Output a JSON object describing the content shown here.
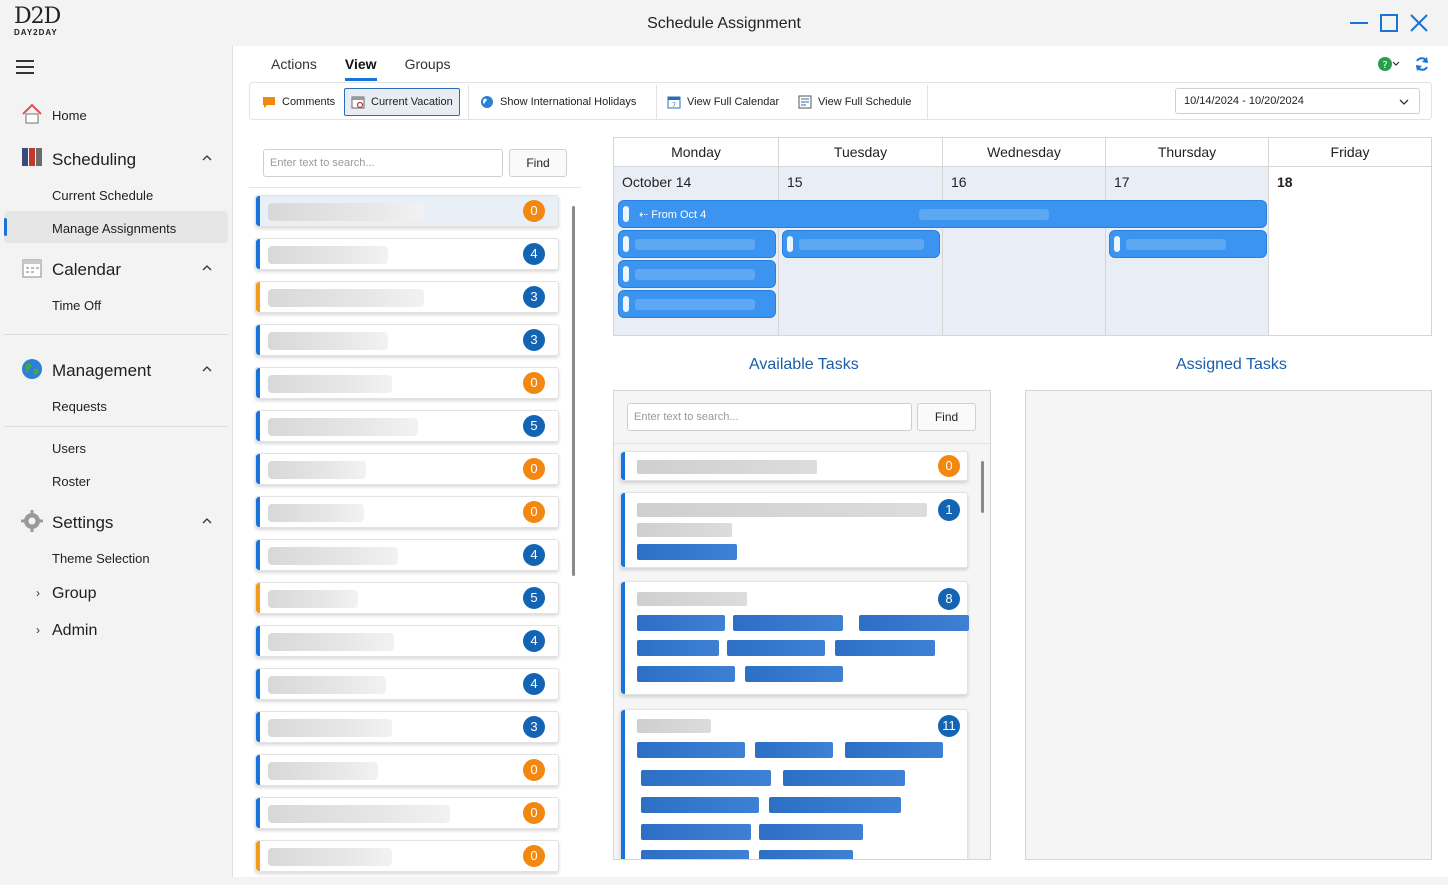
{
  "window": {
    "title": "Schedule Assignment",
    "logo_text": "D2D",
    "logo_sub": "DAY2DAY"
  },
  "sidebar": {
    "home": "Home",
    "scheduling": "Scheduling",
    "current_schedule": "Current Schedule",
    "manage_assignments": "Manage Assignments",
    "calendar": "Calendar",
    "time_off": "Time Off",
    "management": "Management",
    "requests": "Requests",
    "users": "Users",
    "roster": "Roster",
    "settings": "Settings",
    "theme_selection": "Theme Selection",
    "group": "Group",
    "admin": "Admin"
  },
  "tabs": {
    "actions": "Actions",
    "view": "View",
    "groups": "Groups"
  },
  "toolbar": {
    "comments": "Comments",
    "current_vacation": "Current Vacation",
    "show_international_holidays": "Show International Holidays",
    "view_full_calendar": "View Full Calendar",
    "view_full_schedule": "View Full Schedule",
    "date_range": "10/14/2024 - 10/20/2024"
  },
  "search": {
    "placeholder": "Enter text to search...",
    "find": "Find"
  },
  "employees": [
    {
      "count": "0",
      "badge": "orange",
      "stripe": "blue",
      "selected": true
    },
    {
      "count": "4",
      "badge": "blue",
      "stripe": "blue"
    },
    {
      "count": "3",
      "badge": "blue",
      "stripe": "orange"
    },
    {
      "count": "3",
      "badge": "blue",
      "stripe": "blue"
    },
    {
      "count": "0",
      "badge": "orange",
      "stripe": "blue"
    },
    {
      "count": "5",
      "badge": "blue",
      "stripe": "blue"
    },
    {
      "count": "0",
      "badge": "orange",
      "stripe": "blue"
    },
    {
      "count": "0",
      "badge": "orange",
      "stripe": "blue"
    },
    {
      "count": "4",
      "badge": "blue",
      "stripe": "blue"
    },
    {
      "count": "5",
      "badge": "blue",
      "stripe": "orange"
    },
    {
      "count": "4",
      "badge": "blue",
      "stripe": "blue"
    },
    {
      "count": "4",
      "badge": "blue",
      "stripe": "blue"
    },
    {
      "count": "3",
      "badge": "blue",
      "stripe": "blue"
    },
    {
      "count": "0",
      "badge": "orange",
      "stripe": "blue"
    },
    {
      "count": "0",
      "badge": "orange",
      "stripe": "blue"
    },
    {
      "count": "0",
      "badge": "orange",
      "stripe": "orange"
    }
  ],
  "calendar": {
    "days": [
      "Monday",
      "Tuesday",
      "Wednesday",
      "Thursday",
      "Friday"
    ],
    "dates": [
      "October 14",
      "15",
      "16",
      "17",
      "18"
    ],
    "event_label": "From Oct 4"
  },
  "tasks": {
    "available_title": "Available Tasks",
    "assigned_title": "Assigned Tasks",
    "counts": [
      "0",
      "1",
      "8",
      "11"
    ]
  },
  "colors": {
    "accent": "#1a73d9",
    "badge_blue": "#1464b4",
    "badge_orange": "#f2880f",
    "event_blue": "#3b94f0"
  }
}
